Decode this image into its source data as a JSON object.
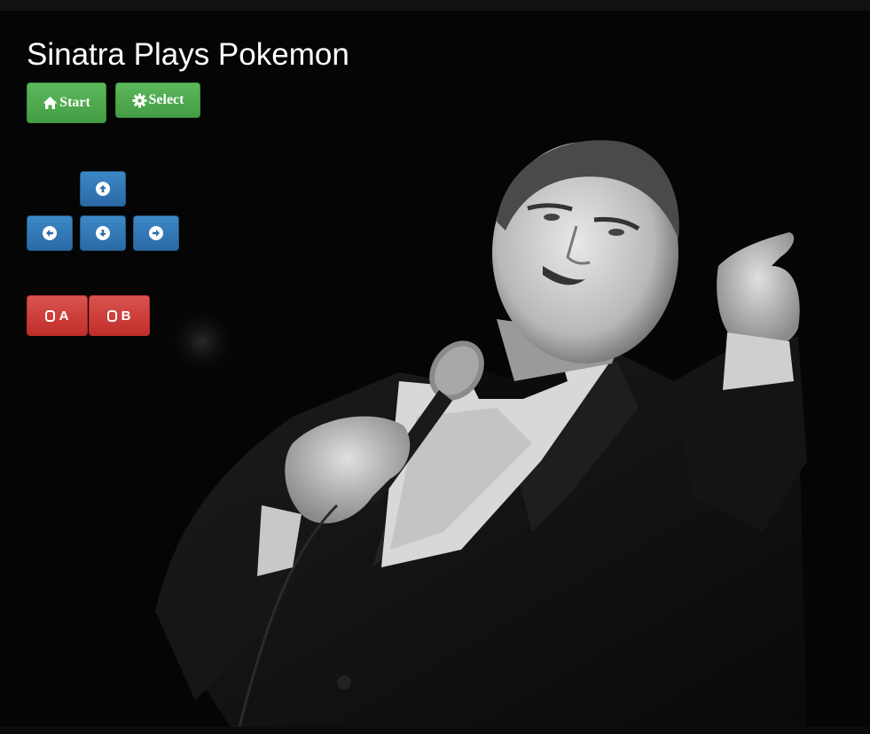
{
  "page": {
    "title": "Sinatra Plays Pokemon"
  },
  "controls": {
    "start_label": "Start",
    "select_label": "Select",
    "a_label": "A",
    "b_label": "B"
  },
  "icons": {
    "start": "home-icon",
    "select": "gear-icon",
    "up": "arrow-up-circle-icon",
    "down": "arrow-down-circle-icon",
    "left": "arrow-left-circle-icon",
    "right": "arrow-right-circle-icon",
    "ab": "unchecked-square-icon"
  },
  "colors": {
    "green": "#4cae4c",
    "blue": "#337ab7",
    "red": "#d9534f",
    "background": "#000000"
  }
}
